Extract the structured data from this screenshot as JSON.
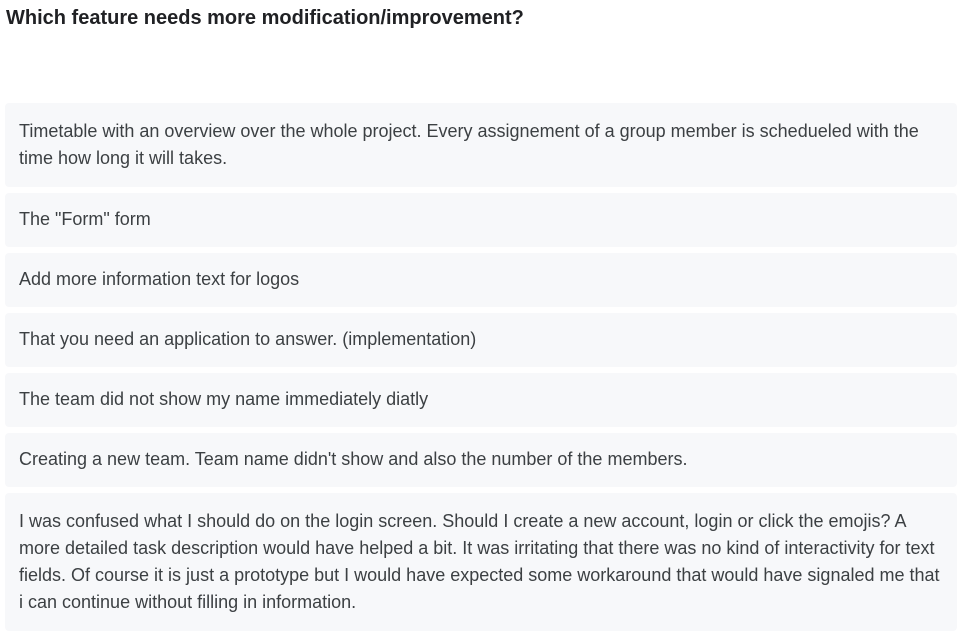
{
  "question": {
    "title": "Which feature needs more modification/improvement?"
  },
  "responses": [
    {
      "text": "Timetable with an overview over the whole project. Every assignement of a group member is schedueled with the time how long it will takes."
    },
    {
      "text": "The \"Form\" form"
    },
    {
      "text": "Add more information text for logos"
    },
    {
      "text": "That you need an application to answer. (implementation)"
    },
    {
      "text": "The team did not show my name immediately diatly"
    },
    {
      "text": "Creating a new team. Team name didn't show and also the number of the members."
    },
    {
      "text": "I was confused what I should do on the login screen. Should I create a new account, login or click the emojis? A more detailed task description would have helped a bit. It was irritating that there was no kind of interactivity for text fields. Of course it is just a prototype but I would have expected some workaround that would have signaled me that i can continue without filling in information."
    }
  ],
  "colors": {
    "card_background": "#f7f8fa",
    "title_text": "#202124",
    "body_text": "#3c4043"
  }
}
